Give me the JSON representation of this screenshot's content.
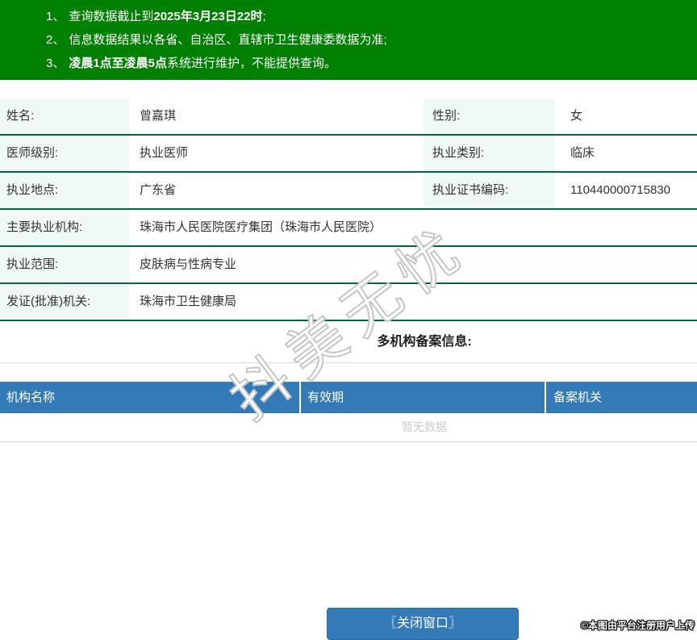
{
  "notices": {
    "items": [
      {
        "num": "1、",
        "pre": "查询数据截止到",
        "bold": "2025年3月23日22时",
        "post": ";"
      },
      {
        "num": "2、",
        "pre": "信息数据结果以各省、自治区、直辖市卫生健康委数据为准;",
        "bold": "",
        "post": ""
      },
      {
        "num": "3、",
        "pre": "",
        "bold": "凌晨1点至凌晨5点",
        "post": "系统进行维护，不能提供查询。"
      }
    ]
  },
  "doctor_info": {
    "name_label": "姓名:",
    "name": "曾嘉琪",
    "gender_label": "性别:",
    "gender": "女",
    "level_label": "医师级别:",
    "level": "执业医师",
    "category_label": "执业类别:",
    "category": "临床",
    "location_label": "执业地点:",
    "location": "广东省",
    "cert_label": "执业证书编码:",
    "cert_no": "110440000715830",
    "org_label": "主要执业机构:",
    "org": "珠海市人民医院医疗集团（珠海市人民医院）",
    "scope_label": "执业范围:",
    "scope": "皮肤病与性病专业",
    "issuer_label": "发证(批准)机关:",
    "issuer": "珠海市卫生健康局"
  },
  "multi_org": {
    "title": "多机构备案信息:",
    "columns": [
      "机构名称",
      "有效期",
      "备案机关"
    ],
    "empty_text": "暂无数据"
  },
  "watermark": {
    "text": "抖美无忧"
  },
  "footer": {
    "close_button": "〖关闭窗口〗",
    "copyright": "©本图由平台注册用户上传"
  },
  "colors": {
    "banner_green": "#008000",
    "row_border_green": "#006644",
    "label_cell_mint": "#f0faf4",
    "table_header_blue": "#337ab7",
    "button_blue": "#337ab7",
    "empty_text_gray": "#cccccc"
  }
}
